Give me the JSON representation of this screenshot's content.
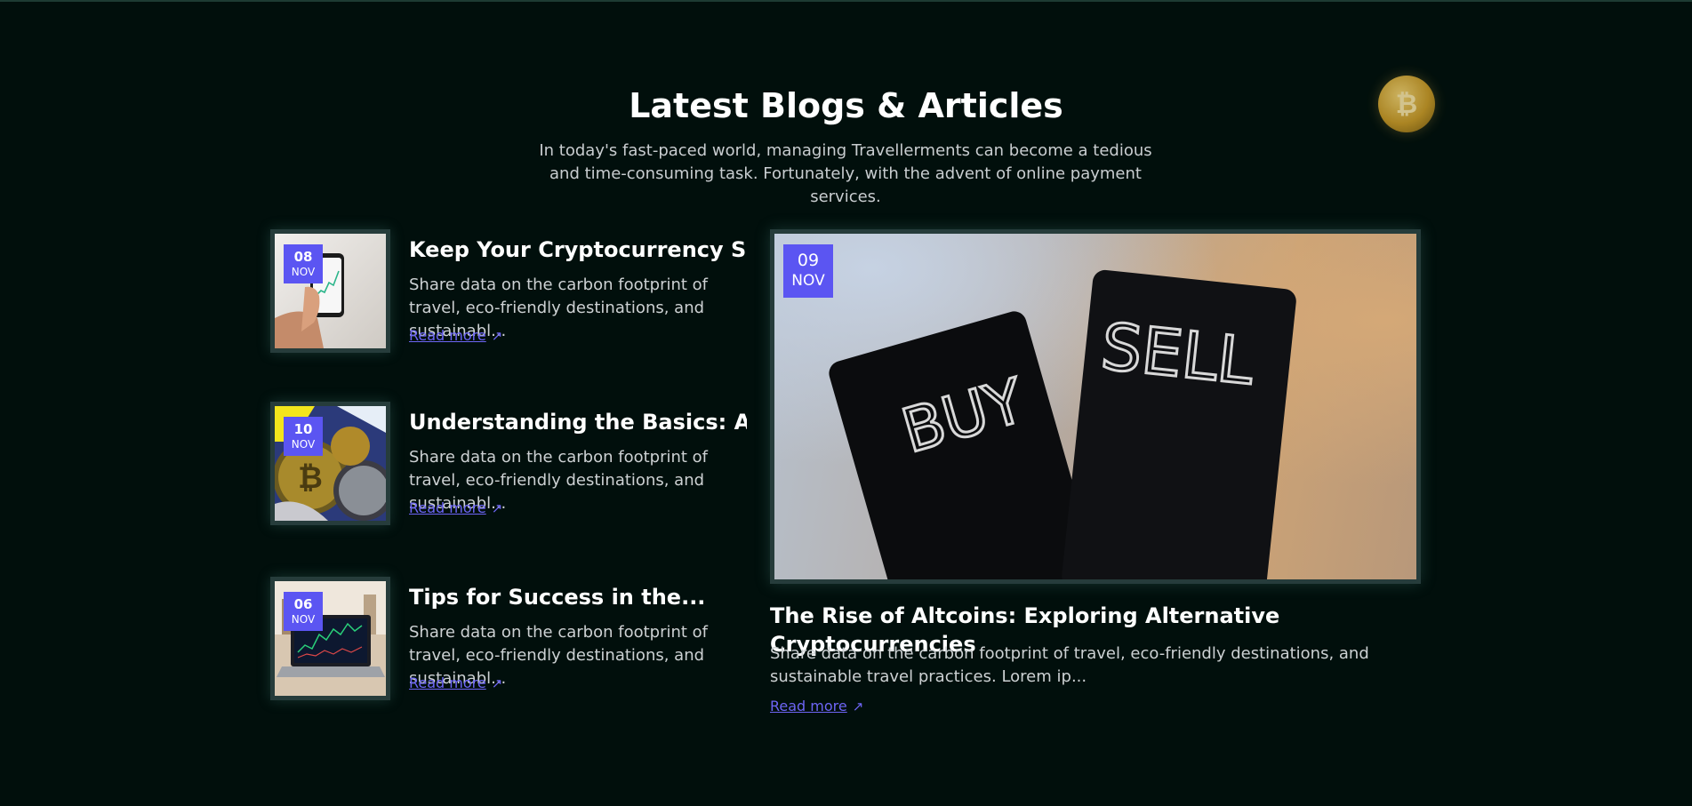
{
  "section": {
    "title": "Latest Blogs & Articles",
    "subtitle": "In today's fast-paced world, managing Travellerments can become a tedious and time-consuming task. Fortunately, with the advent of online payment services."
  },
  "decor": {
    "coin_icon": "bitcoin-coin-icon",
    "coin_glyph": "₿"
  },
  "colors": {
    "background": "#010f0c",
    "accent": "#5b55f2",
    "link": "#6d65f5",
    "frame": "#263c3b"
  },
  "posts": [
    {
      "day": "08",
      "month": "NOV",
      "title": "Keep Your Cryptocurrency Safe",
      "excerpt": "Share data on the carbon footprint of travel, eco-friendly destinations, and sustainabl...",
      "read_more": "Read more",
      "image": "hand-holding-phone-chart"
    },
    {
      "day": "10",
      "month": "NOV",
      "title": "Understanding the Basics: A...",
      "excerpt": "Share data on the carbon footprint of travel, eco-friendly destinations, and sustainabl...",
      "read_more": "Read more",
      "image": "crypto-coins"
    },
    {
      "day": "06",
      "month": "NOV",
      "title": "Tips for Success in the...",
      "excerpt": "Share data on the carbon footprint of travel, eco-friendly destinations, and sustainabl...",
      "read_more": "Read more",
      "image": "laptop-trading-chart"
    }
  ],
  "featured": {
    "day": "09",
    "month": "NOV",
    "title": "The Rise of Altcoins: Exploring Alternative Cryptocurrencies",
    "excerpt": "Share data on the carbon footprint of travel, eco-friendly destinations, and sustainable travel practices. Lorem ip...",
    "read_more": "Read more",
    "image": "buy-sell-cards",
    "image_text_left": "BUY",
    "image_text_right": "SELL"
  },
  "icons": {
    "arrow": "↗"
  }
}
